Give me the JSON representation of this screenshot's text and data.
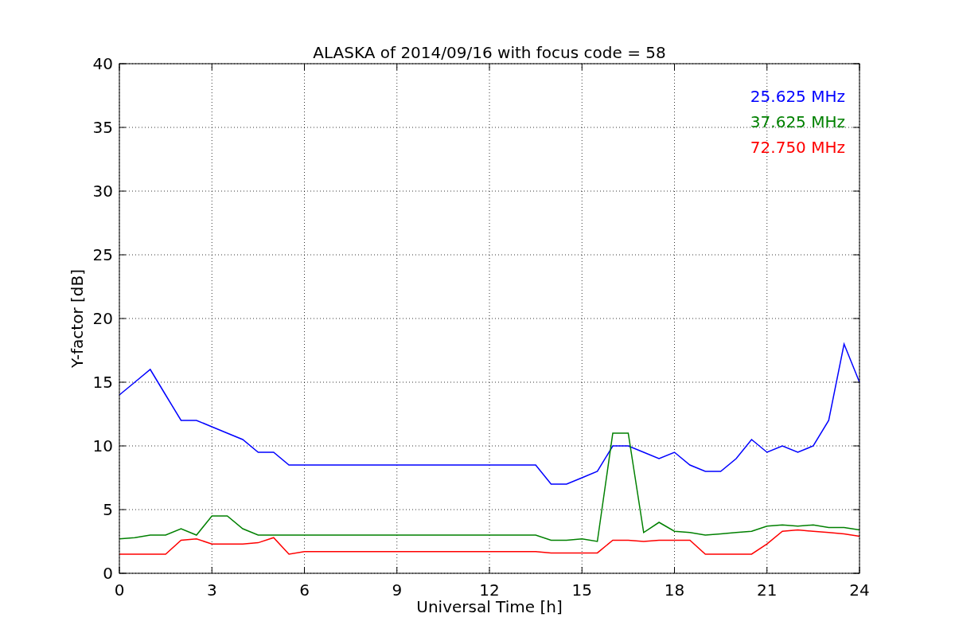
{
  "chart_data": {
    "type": "line",
    "title": "ALASKA of 2014/09/16 with focus code = 58",
    "xlabel": "Universal Time [h]",
    "ylabel": "Y-factor [dB]",
    "x": [
      0,
      0.5,
      1,
      1.5,
      2,
      2.5,
      3,
      3.5,
      4,
      4.5,
      5,
      5.5,
      6,
      6.5,
      7,
      7.5,
      8,
      8.5,
      9,
      9.5,
      10,
      10.5,
      11,
      11.5,
      12,
      12.5,
      13,
      13.5,
      14,
      14.5,
      15,
      15.5,
      16,
      16.5,
      17,
      17.5,
      18,
      18.5,
      19,
      19.5,
      20,
      20.5,
      21,
      21.5,
      22,
      22.5,
      23,
      23.5,
      24
    ],
    "series": [
      {
        "name": "25.625 MHz",
        "color": "#0000ff",
        "values": [
          14,
          15,
          16,
          14,
          12,
          12,
          11.5,
          11,
          10.5,
          9.5,
          9.5,
          8.5,
          8.5,
          8.5,
          8.5,
          8.5,
          8.5,
          8.5,
          8.5,
          8.5,
          8.5,
          8.5,
          8.5,
          8.5,
          8.5,
          8.5,
          8.5,
          8.5,
          7,
          7,
          7.5,
          8,
          10,
          10,
          9.5,
          9,
          9.5,
          8.5,
          8,
          8,
          9,
          10.5,
          9.5,
          10,
          9.5,
          10,
          12,
          18,
          15
        ]
      },
      {
        "name": "37.625 MHz",
        "color": "#008000",
        "values": [
          2.7,
          2.8,
          3,
          3,
          3.5,
          3,
          4.5,
          4.5,
          3.5,
          3,
          3,
          3,
          3,
          3,
          3,
          3,
          3,
          3,
          3,
          3,
          3,
          3,
          3,
          3,
          3,
          3,
          3,
          3,
          2.6,
          2.6,
          2.7,
          2.5,
          11,
          11,
          3.2,
          4,
          3.3,
          3.2,
          3,
          3.1,
          3.2,
          3.3,
          3.7,
          3.8,
          3.7,
          3.8,
          3.6,
          3.6,
          3.4
        ]
      },
      {
        "name": "72.750 MHz",
        "color": "#ff0000",
        "values": [
          1.5,
          1.5,
          1.5,
          1.5,
          2.6,
          2.7,
          2.3,
          2.3,
          2.3,
          2.4,
          2.8,
          1.5,
          1.7,
          1.7,
          1.7,
          1.7,
          1.7,
          1.7,
          1.7,
          1.7,
          1.7,
          1.7,
          1.7,
          1.7,
          1.7,
          1.7,
          1.7,
          1.7,
          1.6,
          1.6,
          1.6,
          1.6,
          2.6,
          2.6,
          2.5,
          2.6,
          2.6,
          2.6,
          1.5,
          1.5,
          1.5,
          1.5,
          2.3,
          3.3,
          3.4,
          3.3,
          3.2,
          3.1,
          2.9
        ]
      }
    ],
    "xlim": [
      0,
      24
    ],
    "ylim": [
      0,
      40
    ],
    "xticks": [
      0,
      3,
      6,
      9,
      12,
      15,
      18,
      21,
      24
    ],
    "yticks": [
      0,
      5,
      10,
      15,
      20,
      25,
      30,
      35,
      40
    ],
    "grid": true
  }
}
